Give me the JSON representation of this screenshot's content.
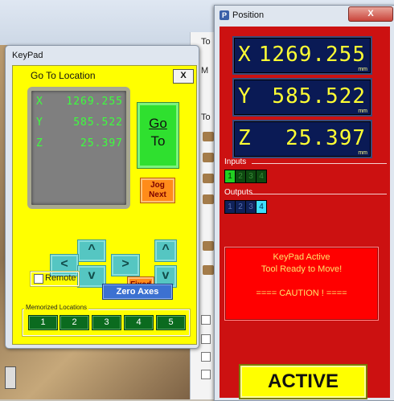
{
  "background": {
    "to_labels": [
      "To",
      "M",
      "To"
    ],
    "colors": {
      "wood": "#8e7352"
    }
  },
  "keypad": {
    "window_title": "KeyPad",
    "panel_title": "Go To Location",
    "close_label": "X",
    "lcd": [
      {
        "axis": "X",
        "value": "1269.255"
      },
      {
        "axis": "Y",
        "value": "585.522"
      },
      {
        "axis": "Z",
        "value": "25.397"
      }
    ],
    "goto": {
      "line1": "Go",
      "line2": "To"
    },
    "jog": {
      "line1": "Jog",
      "line2": "Next"
    },
    "arrows": {
      "left": "<",
      "right": ">",
      "up": "^",
      "down": "v",
      "z_up": "^",
      "z_down": "v"
    },
    "fixed_label": "Fixed",
    "remote_label": "Remote",
    "remote_checked": false,
    "zero_axes_label": "Zero Axes",
    "memorized_label": "Memorized Locations",
    "memorized": [
      "1",
      "2",
      "3",
      "4",
      "5"
    ],
    "colors": {
      "panel": "#ffff00",
      "goto": "#2fe02f",
      "jog": "#ff8c1a",
      "arrow": "#55c6c2",
      "zero": "#3c71d1",
      "memo": "#0b6b1f"
    }
  },
  "position": {
    "window_title": "Position",
    "close_label": "X",
    "dro": [
      {
        "axis": "X",
        "value": "1269.255",
        "unit": "mm"
      },
      {
        "axis": "Y",
        "value": "585.522",
        "unit": "mm"
      },
      {
        "axis": "Z",
        "value": "25.397",
        "unit": "mm"
      }
    ],
    "inputs_label": "Inputs",
    "inputs": [
      {
        "label": "1",
        "on": true
      },
      {
        "label": "2",
        "on": false
      },
      {
        "label": "3",
        "on": false
      },
      {
        "label": "4",
        "on": false
      }
    ],
    "outputs_label": "Outputs",
    "outputs": [
      {
        "label": "1",
        "on": false
      },
      {
        "label": "2",
        "on": false
      },
      {
        "label": "3",
        "on": false
      },
      {
        "label": "4",
        "on": true
      }
    ],
    "messages": [
      "KeyPad Active",
      "Tool Ready to Move!",
      "==== CAUTION ! ===="
    ],
    "active_label": "ACTIVE",
    "colors": {
      "panel": "#cc1111",
      "dro_bg": "#0a1a55",
      "dro_text": "#ffff33",
      "active": "#ffff00"
    }
  }
}
